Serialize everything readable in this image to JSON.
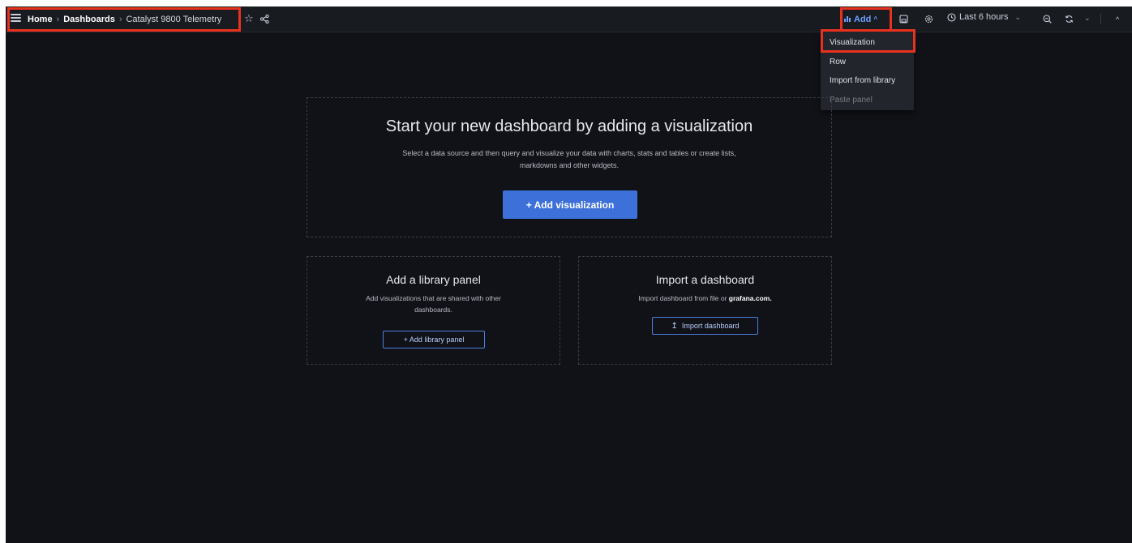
{
  "topbar": {
    "breadcrumb": [
      "Home",
      "Dashboards",
      "Catalyst 9800 Telemetry"
    ],
    "separator": "›",
    "add_label": "Add",
    "time_range_label": "Last 6 hours",
    "icons": [
      "menu-icon",
      "star-icon",
      "share-icon",
      "save-icon",
      "gear-icon",
      "clock-icon",
      "zoom-out-icon",
      "refresh-icon",
      "chevron-down-icon",
      "chevron-up-icon"
    ]
  },
  "add_menu": {
    "items": [
      {
        "label": "Visualization",
        "disabled": false
      },
      {
        "label": "Row",
        "disabled": false
      },
      {
        "label": "Import from library",
        "disabled": false
      },
      {
        "label": "Paste panel",
        "disabled": true
      }
    ]
  },
  "empty_state": {
    "title": "Start your new dashboard by adding a visualization",
    "description_line1": "Select a data source and then query and visualize your data with charts, stats and tables or create lists,",
    "description_line2": "markdowns and other widgets.",
    "button_label": "+ Add visualization"
  },
  "library_card": {
    "title": "Add a library panel",
    "description_line1": "Add visualizations that are shared with other",
    "description_line2": "dashboards.",
    "button_label": "+ Add library panel"
  },
  "import_card": {
    "title": "Import a dashboard",
    "description_prefix": "Import dashboard from file or",
    "description_link": "grafana.com.",
    "button_icon": "↥",
    "button_label": "Import dashboard"
  },
  "colors": {
    "background": "#111217",
    "topbar": "#181b1f",
    "primary": "#3d71d9",
    "link": "#6e9fff",
    "highlight": "#e8321e"
  }
}
